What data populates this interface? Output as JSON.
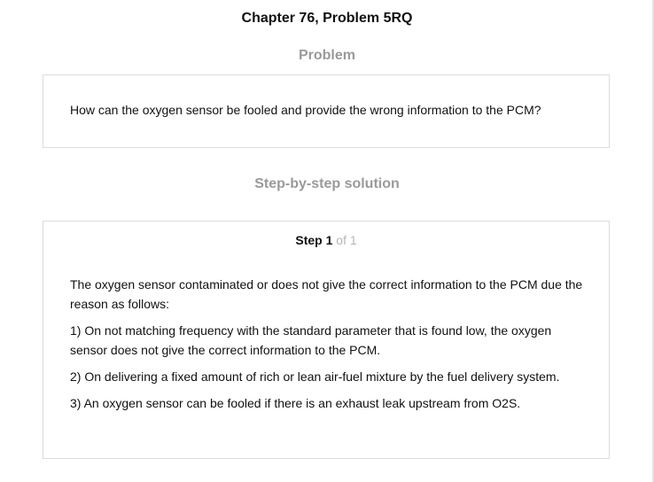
{
  "chapter_title": "Chapter 76, Problem 5RQ",
  "problem": {
    "heading": "Problem",
    "text": "How can the oxygen sensor be fooled and provide the wrong information to the PCM?"
  },
  "solution": {
    "heading": "Step-by-step solution",
    "step_label": "Step",
    "step_number": "1",
    "step_of": "of 1",
    "paragraphs": [
      "The oxygen sensor contaminated or does not give the correct information to the PCM due the reason as follows:",
      "1) On not matching frequency with the standard parameter that is found low, the oxygen sensor does not give the correct information to the PCM.",
      "2) On delivering a fixed amount of rich or lean air-fuel mixture by the fuel delivery system.",
      "3) An oxygen sensor can be fooled if there is an exhaust leak upstream from O2S."
    ]
  }
}
